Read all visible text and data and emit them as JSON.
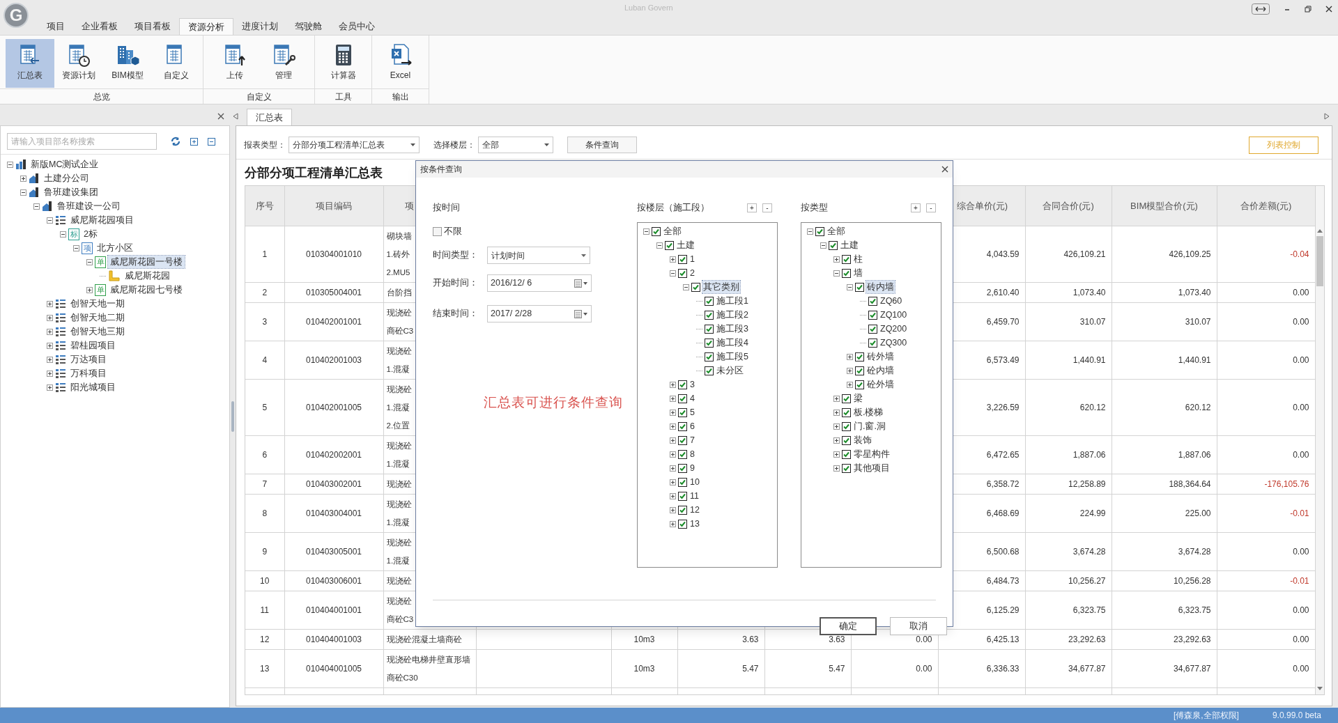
{
  "app": {
    "logo": "G",
    "title": "Luban Govern"
  },
  "ribbon_tabs": [
    {
      "label": "项目",
      "selected": false
    },
    {
      "label": "企业看板",
      "selected": false
    },
    {
      "label": "项目看板",
      "selected": false
    },
    {
      "label": "资源分析",
      "selected": true
    },
    {
      "label": "进度计划",
      "selected": false
    },
    {
      "label": "驾驶舱",
      "selected": false
    },
    {
      "label": "会员中心",
      "selected": false
    }
  ],
  "ribbon_groups": [
    {
      "label": "总览",
      "buttons": [
        {
          "label": "汇总表",
          "selected": true
        },
        {
          "label": "资源计划",
          "selected": false
        },
        {
          "label": "BIM模型",
          "selected": false
        },
        {
          "label": "自定义",
          "selected": false
        }
      ]
    },
    {
      "label": "自定义",
      "buttons": [
        {
          "label": "上传",
          "selected": false
        },
        {
          "label": "管理",
          "selected": false
        }
      ]
    },
    {
      "label": "工具",
      "buttons": [
        {
          "label": "计算器",
          "selected": false
        }
      ]
    },
    {
      "label": "输出",
      "buttons": [
        {
          "label": "Excel",
          "selected": false
        }
      ]
    }
  ],
  "left_panel": {
    "search": {
      "placeholder": "请输入项目部名称搜索"
    },
    "tree": [
      {
        "label": "新版MC测试企业",
        "kind": "company",
        "expanded": true,
        "selected": false,
        "children": [
          {
            "label": "土建分公司",
            "kind": "branch",
            "expanded": false,
            "selected": false
          },
          {
            "label": "鲁班建设集团",
            "kind": "branch",
            "expanded": true,
            "selected": false,
            "children": [
              {
                "label": "鲁班建设一公司",
                "kind": "branch",
                "expanded": true,
                "selected": false,
                "children": [
                  {
                    "label": "威尼斯花园项目",
                    "kind": "project",
                    "expanded": true,
                    "selected": false,
                    "children": [
                      {
                        "label": "2标",
                        "kind": "section",
                        "badge": "标",
                        "expanded": true,
                        "selected": false,
                        "children": [
                          {
                            "label": "北方小区",
                            "kind": "item",
                            "badge": "项",
                            "expanded": true,
                            "selected": false,
                            "children": [
                              {
                                "label": "威尼斯花园一号楼",
                                "kind": "unit",
                                "badge": "单",
                                "expanded": true,
                                "selected": true,
                                "children": [
                                  {
                                    "label": "威尼斯花园",
                                    "kind": "floor",
                                    "selected": false
                                  }
                                ]
                              },
                              {
                                "label": "威尼斯花园七号楼",
                                "kind": "unit",
                                "badge": "单",
                                "expanded": false,
                                "selected": false
                              }
                            ]
                          }
                        ]
                      }
                    ]
                  },
                  {
                    "label": "创智天地一期",
                    "kind": "project",
                    "expanded": false,
                    "selected": false
                  },
                  {
                    "label": "创智天地二期",
                    "kind": "project",
                    "expanded": false,
                    "selected": false
                  },
                  {
                    "label": "创智天地三期",
                    "kind": "project",
                    "expanded": false,
                    "selected": false
                  },
                  {
                    "label": "碧桂园项目",
                    "kind": "project",
                    "expanded": false,
                    "selected": false
                  },
                  {
                    "label": "万达项目",
                    "kind": "project",
                    "expanded": false,
                    "selected": false
                  },
                  {
                    "label": "万科项目",
                    "kind": "project",
                    "expanded": false,
                    "selected": false
                  },
                  {
                    "label": "阳光城项目",
                    "kind": "project",
                    "expanded": false,
                    "selected": false
                  }
                ]
              }
            ]
          }
        ]
      }
    ]
  },
  "doc_tabs": [
    {
      "label": "汇总表",
      "selected": true
    }
  ],
  "toolbar": {
    "report_type_label": "报表类型：",
    "report_type": "分部分项工程清单汇总表",
    "floor_label": "选择楼层：",
    "floor": "全部",
    "query_button": "条件查询",
    "column_control_button": "列表控制"
  },
  "report": {
    "title": "分部分项工程清单汇总表",
    "columns": {
      "seq": "序号",
      "code": "项目编码",
      "name": "项",
      "unit_price": "综合单价(元)",
      "contract_total": "合同合价(元)",
      "bim_total": "BIM模型合价(元)",
      "difference": "合价差额(元)"
    },
    "rows": [
      {
        "seq": "1",
        "code": "010304001010",
        "name": [
          "砌块墙",
          "1.砖外",
          "2.MU5"
        ],
        "unit_price": "4,043.59",
        "contract_total": "426,109.21",
        "bim_total": "426,109.25",
        "difference": "-0.04",
        "flagged": true
      },
      {
        "seq": "2",
        "code": "010305004001",
        "name": [
          "台阶挡"
        ],
        "unit_price": "2,610.40",
        "contract_total": "1,073.40",
        "bim_total": "1,073.40",
        "difference": "0.00",
        "flagged": false
      },
      {
        "seq": "3",
        "code": "010402001001",
        "name": [
          "现浇砼",
          "商砼C3"
        ],
        "unit_price": "6,459.70",
        "contract_total": "310.07",
        "bim_total": "310.07",
        "difference": "0.00",
        "flagged": false
      },
      {
        "seq": "4",
        "code": "010402001003",
        "name": [
          "现浇砼",
          "1.混凝"
        ],
        "unit_price": "6,573.49",
        "contract_total": "1,440.91",
        "bim_total": "1,440.91",
        "difference": "0.00",
        "flagged": false
      },
      {
        "seq": "5",
        "code": "010402001005",
        "name": [
          "现浇砼",
          "1.混凝",
          "2.位置"
        ],
        "unit_price": "3,226.59",
        "contract_total": "620.12",
        "bim_total": "620.12",
        "difference": "0.00",
        "flagged": false
      },
      {
        "seq": "6",
        "code": "010402002001",
        "name": [
          "现浇砼",
          "1.混凝"
        ],
        "unit_price": "6,472.65",
        "contract_total": "1,887.06",
        "bim_total": "1,887.06",
        "difference": "0.00",
        "flagged": false
      },
      {
        "seq": "7",
        "code": "010403002001",
        "name": [
          "现浇砼"
        ],
        "unit_price": "6,358.72",
        "contract_total": "12,258.89",
        "bim_total": "188,364.64",
        "difference": "-176,105.76",
        "flagged": true
      },
      {
        "seq": "8",
        "code": "010403004001",
        "name": [
          "现浇砼",
          "1.混凝"
        ],
        "unit_price": "6,468.69",
        "contract_total": "224.99",
        "bim_total": "225.00",
        "difference": "-0.01",
        "flagged": true
      },
      {
        "seq": "9",
        "code": "010403005001",
        "name": [
          "现浇砼",
          "1.混凝"
        ],
        "unit_price": "6,500.68",
        "contract_total": "3,674.28",
        "bim_total": "3,674.28",
        "difference": "0.00",
        "flagged": false
      },
      {
        "seq": "10",
        "code": "010403006001",
        "name": [
          "现浇砼"
        ],
        "unit_price": "6,484.73",
        "contract_total": "10,256.27",
        "bim_total": "10,256.28",
        "difference": "-0.01",
        "flagged": true
      },
      {
        "seq": "11",
        "code": "010404001001",
        "name": [
          "现浇砼",
          "商砼C3"
        ],
        "unit_price": "6,125.29",
        "contract_total": "6,323.75",
        "bim_total": "6,323.75",
        "difference": "0.00",
        "flagged": false
      },
      {
        "seq": "12",
        "code": "010404001003",
        "name": [
          "现浇砼混凝土墙商砼"
        ],
        "column_5": "10m3",
        "column_6": "3.63",
        "column_7": "3.63",
        "column_8": "0.00",
        "unit_price": "6,425.13",
        "contract_total": "23,292.63",
        "bim_total": "23,292.63",
        "difference": "0.00",
        "flagged": false
      },
      {
        "seq": "13",
        "code": "010404001005",
        "name": [
          "现浇砼电梯井壁直形墙",
          "商砼C30"
        ],
        "column_5": "10m3",
        "column_6": "5.47",
        "column_7": "5.47",
        "column_8": "0.00",
        "unit_price": "6,336.33",
        "contract_total": "34,677.87",
        "bim_total": "34,677.87",
        "difference": "0.00",
        "flagged": false
      }
    ]
  },
  "dialog": {
    "title": "按条件查询",
    "time_section": {
      "heading": "按时间",
      "unlimited": {
        "label": "不限",
        "checked": false
      },
      "time_type_label": "时间类型：",
      "time_type": "计划时间",
      "start_label": "开始时间：",
      "start": "2016/12/ 6",
      "end_label": "结束时间：",
      "end": "2017/ 2/28"
    },
    "note": "汇总表可进行条件查询",
    "floor_tree": {
      "heading": "按楼层（施工段）",
      "expand_button": "+",
      "collapse_button": "-",
      "items": [
        {
          "label": "全部",
          "checked": true,
          "expanded": true,
          "selected": false,
          "children": [
            {
              "label": "土建",
              "checked": true,
              "expanded": true,
              "selected": false,
              "children": [
                {
                  "label": "1",
                  "checked": true,
                  "expanded": false,
                  "selected": false
                },
                {
                  "label": "2",
                  "checked": true,
                  "expanded": true,
                  "selected": false,
                  "children": [
                    {
                      "label": "其它类别",
                      "checked": true,
                      "expanded": true,
                      "selected": true,
                      "children": [
                        {
                          "label": "施工段1",
                          "checked": true,
                          "selected": false
                        },
                        {
                          "label": "施工段2",
                          "checked": true,
                          "selected": false
                        },
                        {
                          "label": "施工段3",
                          "checked": true,
                          "selected": false
                        },
                        {
                          "label": "施工段4",
                          "checked": true,
                          "selected": false
                        },
                        {
                          "label": "施工段5",
                          "checked": true,
                          "selected": false
                        },
                        {
                          "label": "未分区",
                          "checked": true,
                          "selected": false
                        }
                      ]
                    }
                  ]
                },
                {
                  "label": "3",
                  "checked": true,
                  "expanded": false,
                  "selected": false
                },
                {
                  "label": "4",
                  "checked": true,
                  "expanded": false,
                  "selected": false
                },
                {
                  "label": "5",
                  "checked": true,
                  "expanded": false,
                  "selected": false
                },
                {
                  "label": "6",
                  "checked": true,
                  "expanded": false,
                  "selected": false
                },
                {
                  "label": "7",
                  "checked": true,
                  "expanded": false,
                  "selected": false
                },
                {
                  "label": "8",
                  "checked": true,
                  "expanded": false,
                  "selected": false
                },
                {
                  "label": "9",
                  "checked": true,
                  "expanded": false,
                  "selected": false
                },
                {
                  "label": "10",
                  "checked": true,
                  "expanded": false,
                  "selected": false
                },
                {
                  "label": "11",
                  "checked": true,
                  "expanded": false,
                  "selected": false
                },
                {
                  "label": "12",
                  "checked": true,
                  "expanded": false,
                  "selected": false
                },
                {
                  "label": "13",
                  "checked": true,
                  "expanded": false,
                  "selected": false
                }
              ]
            }
          ]
        }
      ]
    },
    "type_tree": {
      "heading": "按类型",
      "expand_button": "+",
      "collapse_button": "-",
      "items": [
        {
          "label": "全部",
          "checked": true,
          "expanded": true,
          "selected": false,
          "children": [
            {
              "label": "土建",
              "checked": true,
              "expanded": true,
              "selected": false,
              "children": [
                {
                  "label": "柱",
                  "checked": true,
                  "expanded": false,
                  "selected": false
                },
                {
                  "label": "墙",
                  "checked": true,
                  "expanded": true,
                  "selected": false,
                  "children": [
                    {
                      "label": "砖内墙",
                      "checked": true,
                      "expanded": true,
                      "selected": true,
                      "children": [
                        {
                          "label": "ZQ60",
                          "checked": true,
                          "selected": false
                        },
                        {
                          "label": "ZQ100",
                          "checked": true,
                          "selected": false
                        },
                        {
                          "label": "ZQ200",
                          "checked": true,
                          "selected": false
                        },
                        {
                          "label": "ZQ300",
                          "checked": true,
                          "selected": false
                        }
                      ]
                    },
                    {
                      "label": "砖外墙",
                      "checked": true,
                      "expanded": false,
                      "selected": false
                    },
                    {
                      "label": "砼内墙",
                      "checked": true,
                      "expanded": false,
                      "selected": false
                    },
                    {
                      "label": "砼外墙",
                      "checked": true,
                      "expanded": false,
                      "selected": false
                    }
                  ]
                },
                {
                  "label": "梁",
                  "checked": true,
                  "expanded": false,
                  "selected": false
                },
                {
                  "label": "板.楼梯",
                  "checked": true,
                  "expanded": false,
                  "selected": false
                },
                {
                  "label": "门.窗.洞",
                  "checked": true,
                  "expanded": false,
                  "selected": false
                },
                {
                  "label": "装饰",
                  "checked": true,
                  "expanded": false,
                  "selected": false
                },
                {
                  "label": "零星构件",
                  "checked": true,
                  "expanded": false,
                  "selected": false
                },
                {
                  "label": "其他项目",
                  "checked": true,
                  "expanded": false,
                  "selected": false
                }
              ]
            }
          ]
        }
      ]
    },
    "buttons": [
      "确定",
      "取消"
    ]
  },
  "status_bar": {
    "user": "[傅森泉,全部权限]",
    "version": "9.0.99.0 beta"
  }
}
